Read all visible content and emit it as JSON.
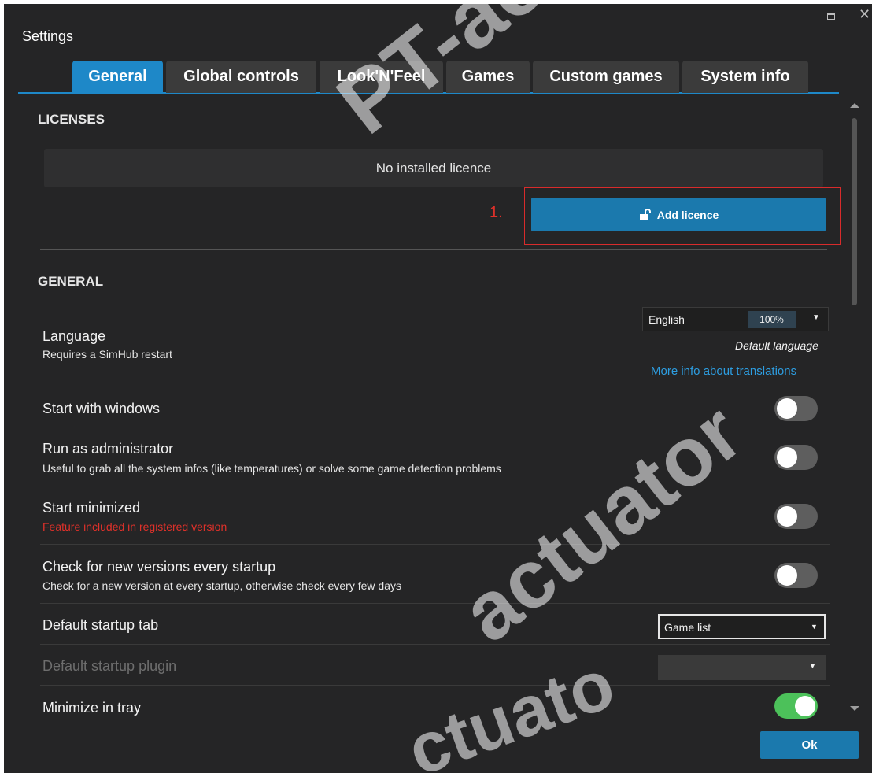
{
  "window": {
    "title": "Settings"
  },
  "tabs": [
    {
      "label": "General",
      "active": true
    },
    {
      "label": "Global controls"
    },
    {
      "label": "Look'N'Feel"
    },
    {
      "label": "Games"
    },
    {
      "label": "Custom games"
    },
    {
      "label": "System info"
    }
  ],
  "licenses": {
    "heading": "LICENSES",
    "empty_text": "No installed licence",
    "marker": "1.",
    "add_button": "Add licence"
  },
  "general": {
    "heading": "GENERAL",
    "language": {
      "label": "Language",
      "sub": "Requires a SimHub restart",
      "value": "English",
      "percent": "100%",
      "default_text": "Default language",
      "link": "More info about translations"
    },
    "start_with_windows": {
      "label": "Start with windows",
      "on": false
    },
    "run_as_admin": {
      "label": "Run as administrator",
      "sub": "Useful to grab all the system infos (like temperatures) or solve some game detection problems",
      "on": false
    },
    "start_minimized": {
      "label": "Start minimized",
      "sub": "Feature included in registered version",
      "on": false
    },
    "check_versions": {
      "label": "Check for new versions every startup",
      "sub": "Check for a new version at every startup, otherwise check every few days",
      "on": false
    },
    "default_tab": {
      "label": "Default startup tab",
      "value": "Game list"
    },
    "default_plugin": {
      "label": "Default startup plugin",
      "value": ""
    },
    "minimize_tray": {
      "label": "Minimize in tray",
      "on": true
    }
  },
  "footer": {
    "ok_label": "Ok"
  },
  "watermark": {
    "text_top": "PT-actuato",
    "text_mid": "actuator",
    "text_bottom": "ctuato"
  },
  "colors": {
    "accent": "#1e88c8",
    "button": "#1b79ad",
    "background": "#252526",
    "warning": "#e0312a",
    "toggle_on": "#4cc15a",
    "link": "#2d9de0"
  }
}
